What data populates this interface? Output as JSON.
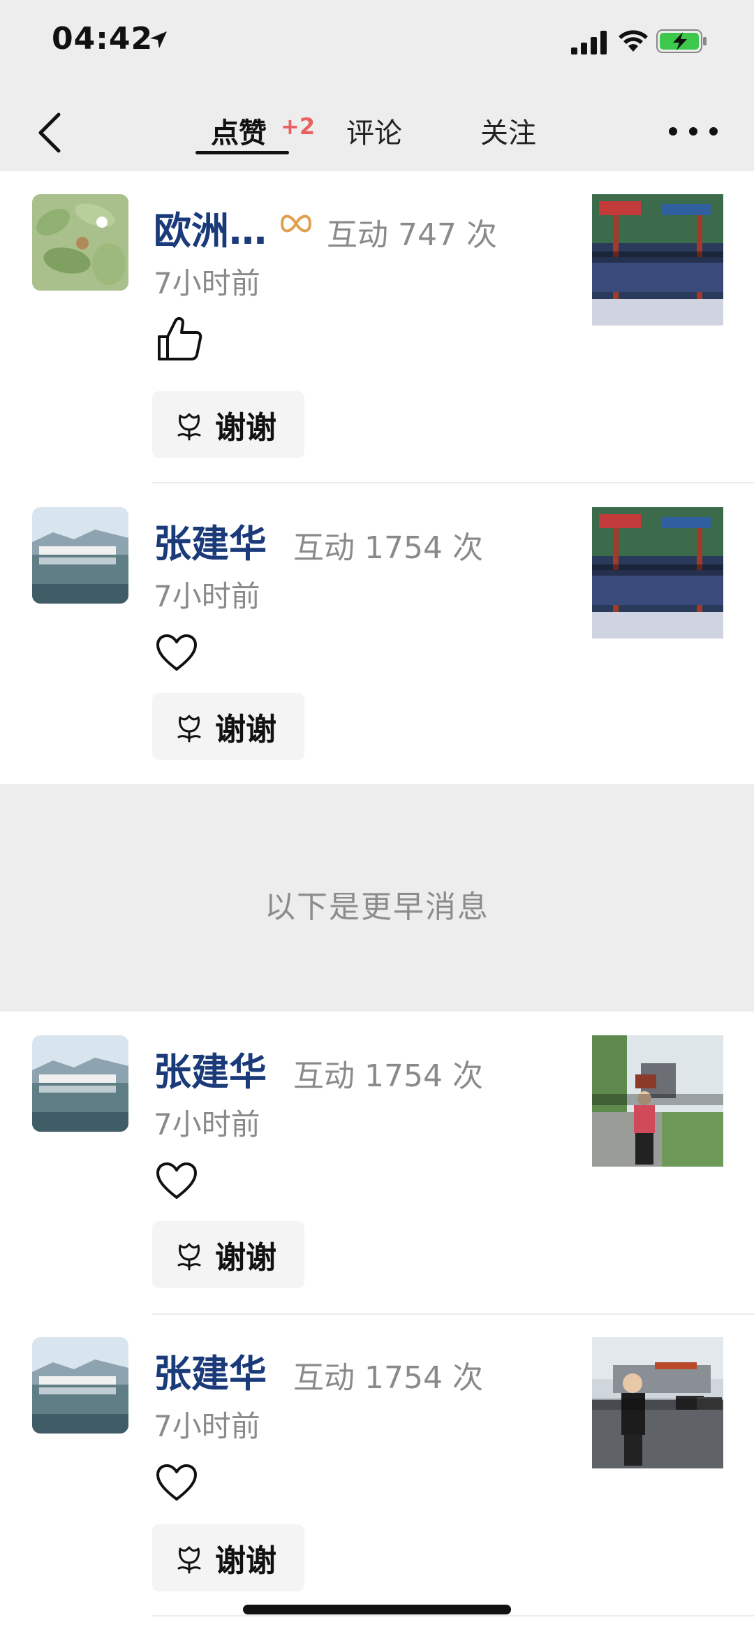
{
  "status_bar": {
    "time": "04:42"
  },
  "nav": {
    "tabs": [
      {
        "label": "点赞",
        "badge": "+2"
      },
      {
        "label": "评论"
      },
      {
        "label": "关注"
      }
    ]
  },
  "items": [
    {
      "name": "欧洲…",
      "interaction": "互动 747 次",
      "time": "7小时前",
      "reaction_icon": "thumbs-up-icon",
      "thanks_label": "谢谢",
      "thumb": "temple-ceiling-photo"
    },
    {
      "name": "张建华",
      "interaction": "互动 1754 次",
      "time": "7小时前",
      "reaction_icon": "heart-icon",
      "thanks_label": "谢谢",
      "thumb": "temple-ceiling-photo"
    },
    {
      "name": "张建华",
      "interaction": "互动 1754 次",
      "time": "7小时前",
      "reaction_icon": "heart-icon",
      "thanks_label": "谢谢",
      "thumb": "man-outdoors-photo"
    },
    {
      "name": "张建华",
      "interaction": "互动 1754 次",
      "time": "7小时前",
      "reaction_icon": "heart-icon",
      "thanks_label": "谢谢",
      "thumb": "man-parking-lot-photo"
    }
  ],
  "earlier_separator": "以下是更早消息",
  "colors": {
    "name": "#1a3a7a",
    "badge": "#e86060",
    "secondary": "#8a8a8a",
    "bar_bg": "#ededed"
  }
}
